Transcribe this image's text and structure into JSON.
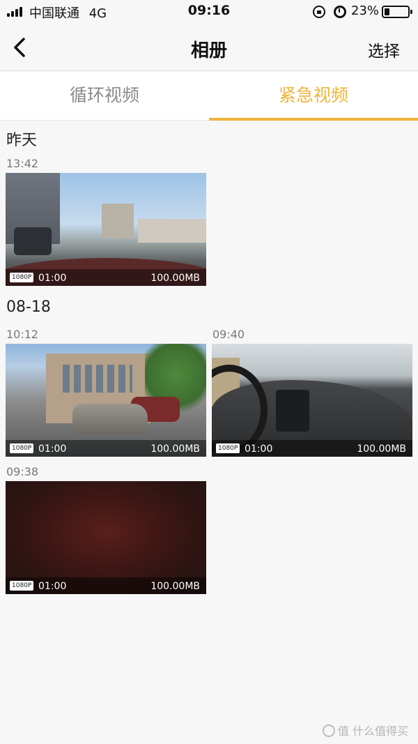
{
  "status_bar": {
    "carrier": "中国联通",
    "network": "4G",
    "time": "09:16",
    "battery_percent": "23%",
    "battery_level": 0.23
  },
  "nav": {
    "title": "相册",
    "select_label": "选择",
    "back_icon": "chevron-left-icon"
  },
  "tabs": [
    {
      "label": "循环视频",
      "active": false
    },
    {
      "label": "紧急视频",
      "active": true
    }
  ],
  "accent_color": "#f0b43a",
  "sections": [
    {
      "date": "昨天",
      "videos": [
        {
          "time": "13:42",
          "resolution": "1080P",
          "duration": "01:00",
          "size": "100.00MB"
        }
      ]
    },
    {
      "date": "08-18",
      "videos": [
        {
          "time": "10:12",
          "resolution": "1080P",
          "duration": "01:00",
          "size": "100.00MB"
        },
        {
          "time": "09:40",
          "resolution": "1080P",
          "duration": "01:00",
          "size": "100.00MB"
        },
        {
          "time": "09:38",
          "resolution": "1080P",
          "duration": "01:00",
          "size": "100.00MB"
        }
      ]
    }
  ],
  "watermark": "值 什么值得买"
}
